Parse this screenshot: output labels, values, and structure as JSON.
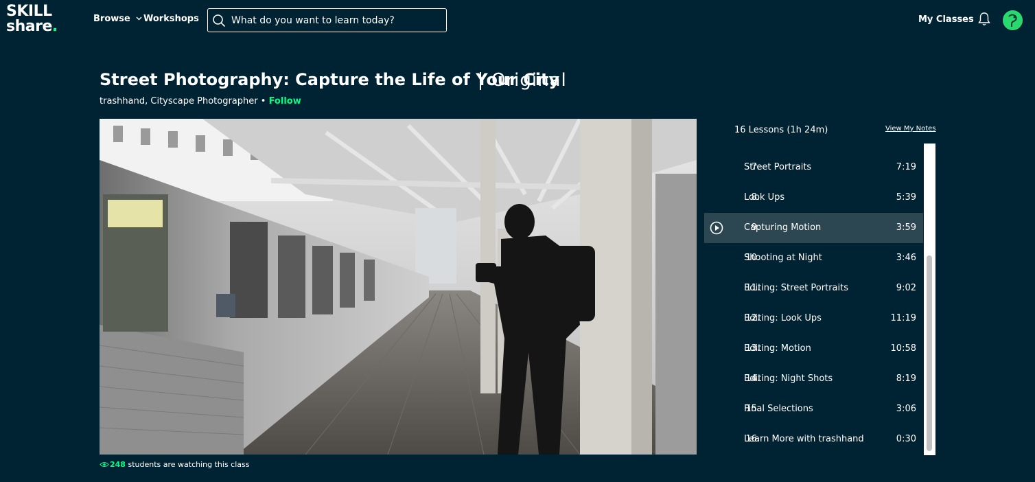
{
  "header": {
    "logo_line1": "SKILL",
    "logo_line2": "share",
    "browse_label": "Browse",
    "workshops_label": "Workshops",
    "search_placeholder": "What do you want to learn today?",
    "my_classes_label": "My Classes",
    "icons": {
      "search": "search-icon",
      "bell": "bell-icon",
      "avatar": "avatar"
    }
  },
  "class": {
    "title": "Street Photography: Capture the Life of Your City",
    "badge": "Original",
    "teacher": "trashhand, Cityscape Photographer",
    "separator": "•",
    "follow_label": "Follow",
    "watching_count": "248",
    "watching_text": "students are watching this class"
  },
  "lessons_panel": {
    "summary": "16 Lessons (1h 24m)",
    "view_notes_label": "View My Notes",
    "lessons": [
      {
        "number": "7.",
        "title": "Street Portraits",
        "duration": "7:19",
        "active": false
      },
      {
        "number": "8.",
        "title": "Look Ups",
        "duration": "5:39",
        "active": false
      },
      {
        "number": "9.",
        "title": "Capturing Motion",
        "duration": "3:59",
        "active": true
      },
      {
        "number": "10.",
        "title": "Shooting at Night",
        "duration": "3:46",
        "active": false
      },
      {
        "number": "11.",
        "title": "Editing: Street Portraits",
        "duration": "9:02",
        "active": false
      },
      {
        "number": "12.",
        "title": "Editing: Look Ups",
        "duration": "11:19",
        "active": false
      },
      {
        "number": "13.",
        "title": "Editing: Motion",
        "duration": "10:58",
        "active": false
      },
      {
        "number": "14.",
        "title": "Editing: Night Shots",
        "duration": "8:19",
        "active": false
      },
      {
        "number": "15.",
        "title": "Final Selections",
        "duration": "3:06",
        "active": false
      },
      {
        "number": "16.",
        "title": "Learn More with trashhand",
        "duration": "0:30",
        "active": false
      }
    ]
  },
  "colors": {
    "background": "#002333",
    "accent_green": "#00ff84",
    "active_row": "#2c4652"
  }
}
